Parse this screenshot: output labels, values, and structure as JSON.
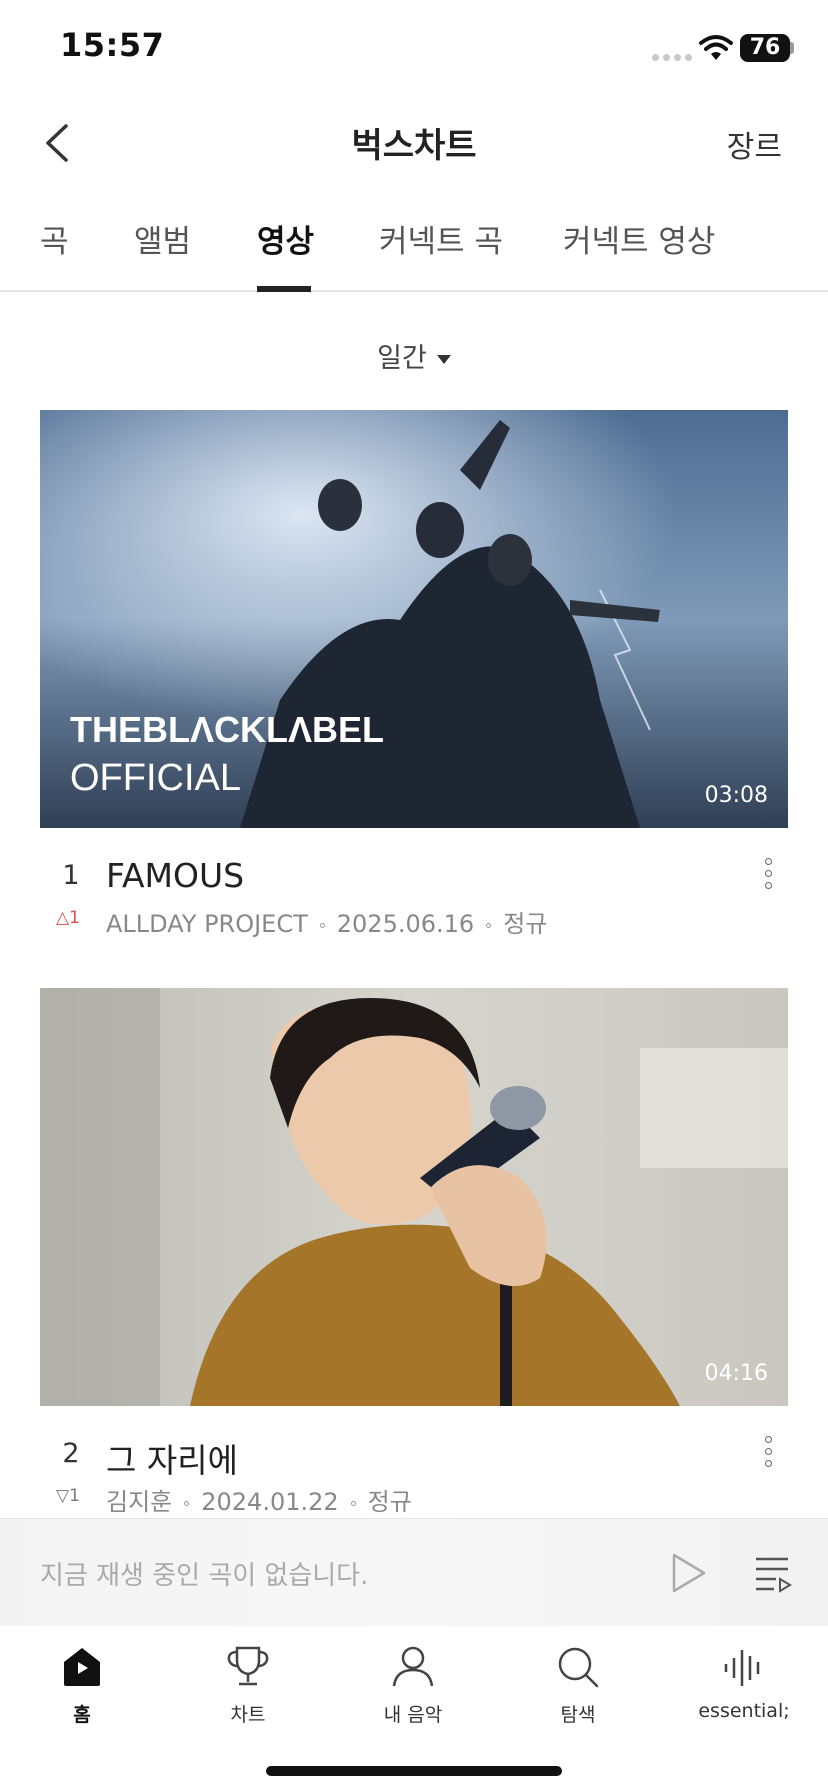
{
  "status_bar": {
    "time": "15:57",
    "battery": "76"
  },
  "header": {
    "title": "벅스차트",
    "genre_label": "장르"
  },
  "tabs": [
    {
      "label": "곡",
      "active": false
    },
    {
      "label": "앨범",
      "active": false
    },
    {
      "label": "영상",
      "active": true
    },
    {
      "label": "커넥트 곡",
      "active": false
    },
    {
      "label": "커넥트 영상",
      "active": false
    }
  ],
  "period": {
    "selected": "일간"
  },
  "videos": [
    {
      "rank": "1",
      "rank_change": "1",
      "rank_direction": "up",
      "title": "FAMOUS",
      "artist": "ALLDAY PROJECT",
      "date": "2025.06.16",
      "type": "정규",
      "duration": "03:08",
      "thumb_text_1": "THEBLΛCKLΛBEL",
      "thumb_text_2": "OFFICIAL"
    },
    {
      "rank": "2",
      "rank_change": "1",
      "rank_direction": "down",
      "title": "그 자리에",
      "artist": "김지훈",
      "date": "2024.01.22",
      "type": "정규",
      "duration": "04:16"
    }
  ],
  "player": {
    "now_playing": "지금 재생 중인 곡이 없습니다."
  },
  "nav": [
    {
      "label": "홈",
      "icon": "home-icon",
      "active": true
    },
    {
      "label": "차트",
      "icon": "trophy-icon",
      "active": false
    },
    {
      "label": "내 음악",
      "icon": "person-icon",
      "active": false
    },
    {
      "label": "탐색",
      "icon": "search-icon",
      "active": false
    },
    {
      "label": "essential;",
      "icon": "soundwave-icon",
      "active": false
    }
  ],
  "colors": {
    "accent": "#222222",
    "rank_up": "#e04b4b",
    "rank_down": "#777777",
    "muted_text": "#888888"
  }
}
